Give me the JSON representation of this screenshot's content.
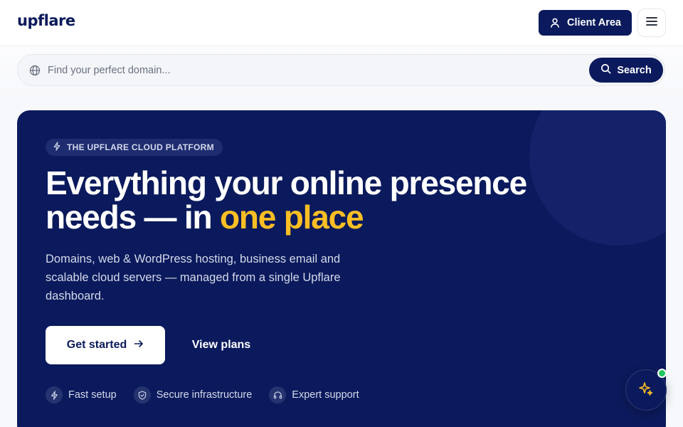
{
  "header": {
    "logo": "upflare",
    "client_area_label": "Client Area",
    "menu_icon": "hamburger-icon"
  },
  "search": {
    "placeholder": "Find your perfect domain...",
    "button_label": "Search",
    "icon": "globe-icon"
  },
  "hero": {
    "badge": "THE UPFLARE CLOUD PLATFORM",
    "headline_line1": "Everything your online presence",
    "headline_line2_prefix": "needs — in ",
    "headline_accent": "one place",
    "subtext": "Domains, web & WordPress hosting, business email and scalable cloud servers — managed from a single Upflare dashboard.",
    "cta_primary": "Get started",
    "cta_secondary": "View plans",
    "features": [
      {
        "label": "Fast setup",
        "icon": "bolt-icon"
      },
      {
        "label": "Secure infrastructure",
        "icon": "shield-check-icon"
      },
      {
        "label": "Expert support",
        "icon": "headset-icon"
      }
    ]
  },
  "colors": {
    "brand_navy": "#0b1a5c",
    "accent_yellow": "#fbbf24",
    "online_green": "#22c55e"
  }
}
